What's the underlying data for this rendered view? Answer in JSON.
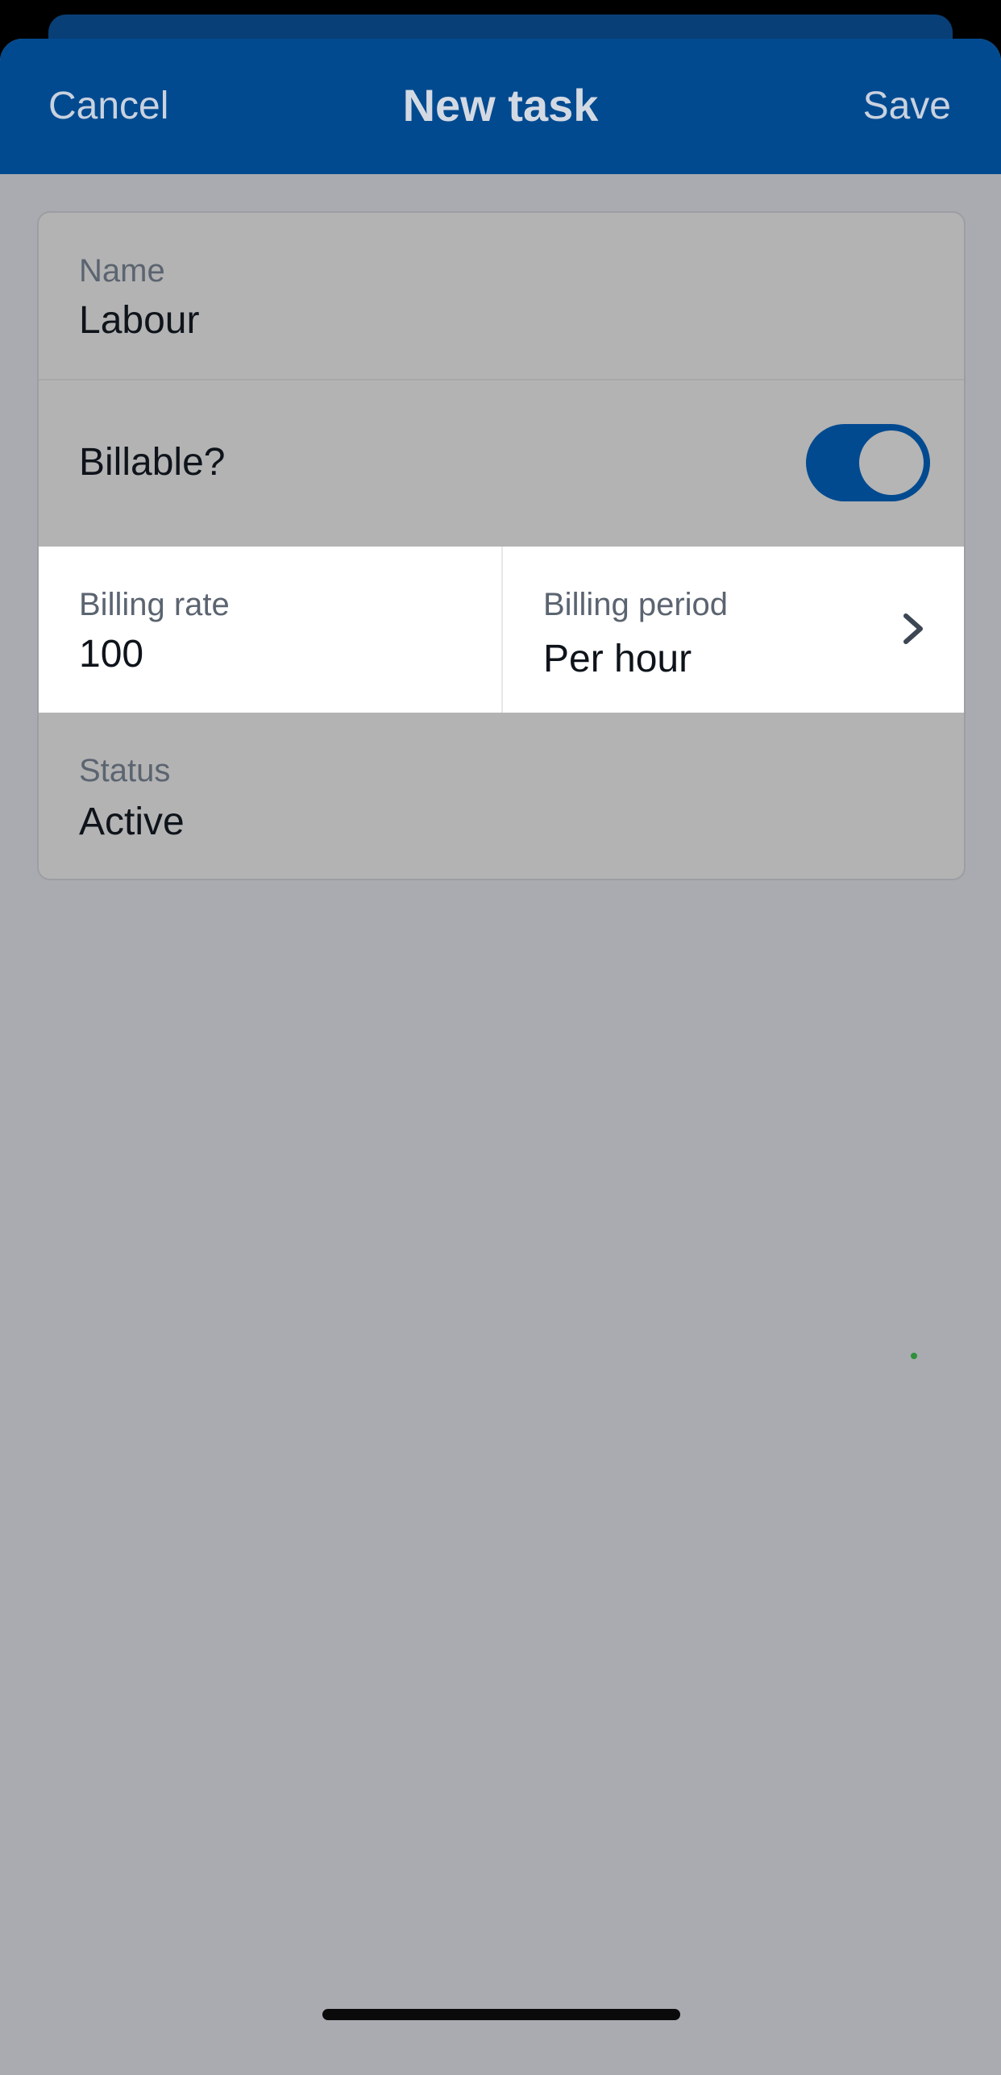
{
  "navbar": {
    "cancel_label": "Cancel",
    "title": "New task",
    "save_label": "Save"
  },
  "form": {
    "name": {
      "label": "Name",
      "value": "Labour"
    },
    "billable": {
      "label": "Billable?",
      "enabled": true
    },
    "billing_rate": {
      "label": "Billing rate",
      "value": "100"
    },
    "billing_period": {
      "label": "Billing period",
      "value": "Per hour"
    },
    "status": {
      "label": "Status",
      "value": "Active"
    }
  },
  "icons": {
    "billing_period_chevron": "chevron-right-icon"
  },
  "colors": {
    "navbar_bg": "#024a90",
    "toggle_on": "#024a90",
    "overlay_bg": "#a9abb0"
  }
}
